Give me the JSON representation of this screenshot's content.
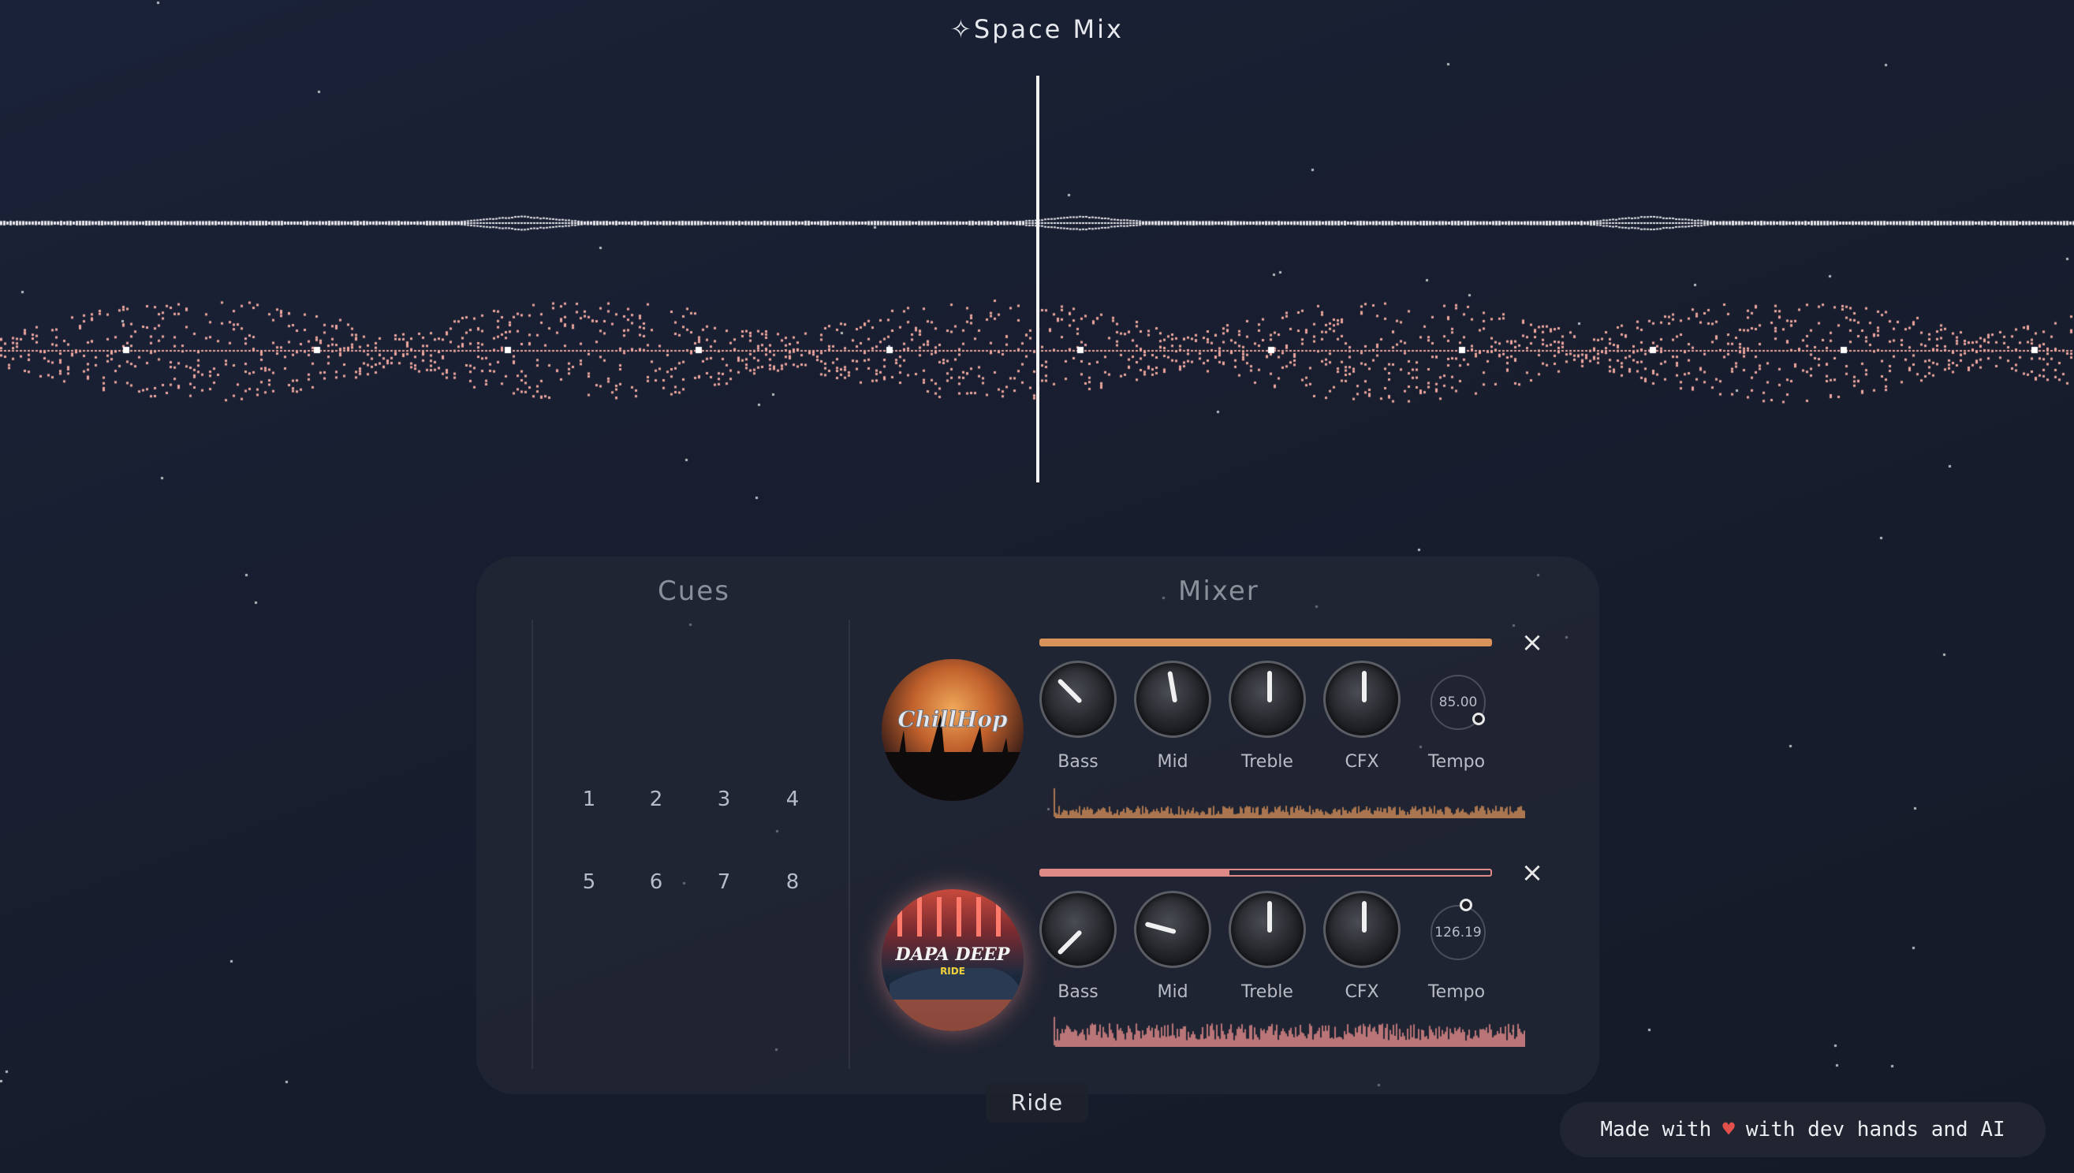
{
  "app": {
    "title": "✧Space Mix"
  },
  "cues": {
    "title": "Cues",
    "buttons": [
      "1",
      "2",
      "3",
      "4",
      "5",
      "6",
      "7",
      "8"
    ]
  },
  "mixer": {
    "title": "Mixer",
    "decks": [
      {
        "album": "ChillHop",
        "accent": "#d9925a",
        "volume": 1.0,
        "knobs": [
          {
            "label": "Bass",
            "angle": -45
          },
          {
            "label": "Mid",
            "angle": -10
          },
          {
            "label": "Treble",
            "angle": 0
          },
          {
            "label": "CFX",
            "angle": 0
          }
        ],
        "tempo_label": "Tempo",
        "tempo_value": "85.00"
      },
      {
        "album": "DAPA DEEP",
        "album_sub": "RIDE",
        "accent": "#e08a88",
        "volume": 0.42,
        "knobs": [
          {
            "label": "Bass",
            "angle": -135
          },
          {
            "label": "Mid",
            "angle": -75
          },
          {
            "label": "Treble",
            "angle": 0
          },
          {
            "label": "CFX",
            "angle": 0
          }
        ],
        "tempo_label": "Tempo",
        "tempo_value": "126.19"
      }
    ]
  },
  "now_playing": {
    "track": "Ride"
  },
  "credit": {
    "prefix": "Made with",
    "heart": "♥",
    "suffix": "with dev hands and AI"
  },
  "colors": {
    "wave_top": "#e8e8ec",
    "wave_bottom": "#f0a8a0",
    "background": "#181e2f"
  }
}
